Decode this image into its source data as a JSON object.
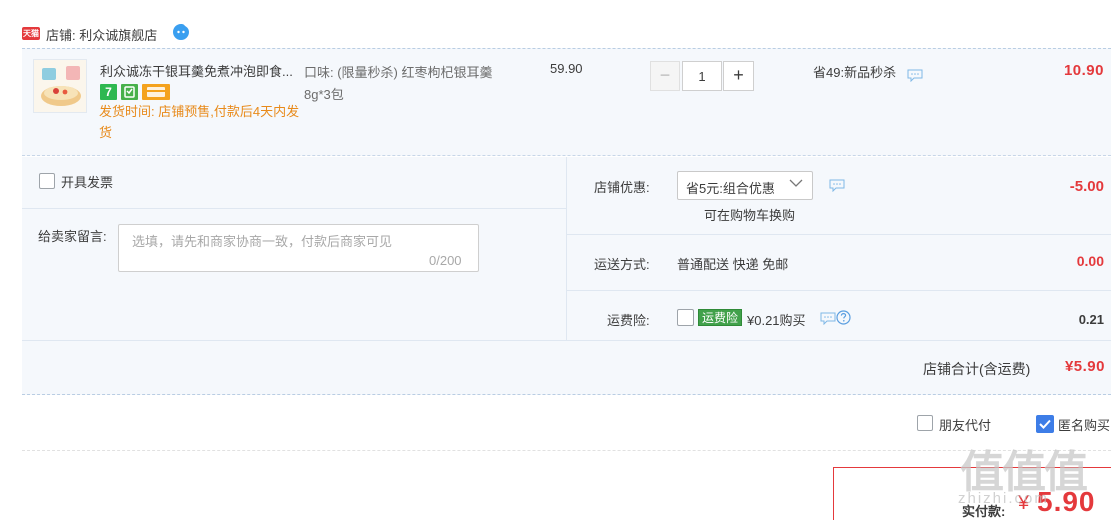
{
  "shop": {
    "logo_text": "天猫",
    "label": "店铺: 利众诚旗舰店"
  },
  "product": {
    "title": "利众诚冻干银耳羹免煮冲泡即食...",
    "ship_time": "发货时间: 店铺预售,付款后4天内发货",
    "sku": "口味: (限量秒杀) 红枣枸杞银耳羹8g*3包",
    "unit_price": "59.90",
    "qty_minus": "−",
    "quantity": "1",
    "qty_plus": "+",
    "promo": "省49:新品秒杀",
    "line_total": "10.90",
    "badge_7": "7"
  },
  "invoice": {
    "label": "开具发票"
  },
  "remark": {
    "label": "给卖家留言:",
    "placeholder": "选填，请先和商家协商一致，付款后商家可见",
    "count": "0/200"
  },
  "shop_discount": {
    "label": "店铺优惠:",
    "selected": "省5元:组合优惠",
    "note": "可在购物车换购",
    "amount": "-5.00"
  },
  "shipping": {
    "label": "运送方式:",
    "value": "普通配送 快递 免邮",
    "amount": "0.00"
  },
  "insurance": {
    "label": "运费险:",
    "tag": "运费险",
    "price": "¥0.21购买",
    "amount": "0.21"
  },
  "shop_total": {
    "label": "店铺合计(含运费)",
    "amount": "¥5.90"
  },
  "options": {
    "friend_pay": "朋友代付",
    "anonymous": "匿名购买"
  },
  "payment": {
    "label": "实付款:",
    "yen": "¥",
    "amount": "5.90"
  },
  "watermark": {
    "main": "值值值",
    "sub": "zhizhi.com"
  },
  "colors": {
    "price_red": "#e4393c",
    "ship_orange": "#e88a1a",
    "checkbox_blue": "#3d7de7",
    "panel_bg": "#f5f8fc"
  }
}
